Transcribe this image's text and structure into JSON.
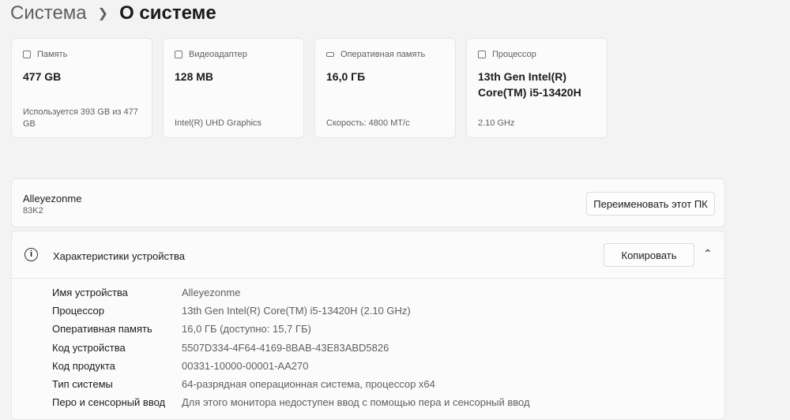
{
  "breadcrumb": {
    "parent": "Система",
    "current": "О системе"
  },
  "cards": [
    {
      "icon": "storage-icon",
      "label": "Память",
      "value": "477 GB",
      "sub": "Используется 393 GB из 477 GB"
    },
    {
      "icon": "display-adapter-icon",
      "label": "Видеоадаптер",
      "value": "128 MB",
      "sub": "Intel(R) UHD Graphics"
    },
    {
      "icon": "ram-icon",
      "label": "Оперативная память",
      "value": "16,0 ГБ",
      "sub": "Скорость: 4800 МТ/с"
    },
    {
      "icon": "cpu-icon",
      "label": "Процессор",
      "value": "13th Gen Intel(R) Core(TM) i5-13420H",
      "sub": "2.10 GHz"
    }
  ],
  "device": {
    "name": "Alleyezonme",
    "model": "83K2",
    "rename_label": "Переименовать этот ПК"
  },
  "specs": {
    "title": "Характеристики устройства",
    "copy_label": "Копировать",
    "rows": [
      {
        "k": "Имя устройства",
        "v": "Alleyezonme"
      },
      {
        "k": "Процессор",
        "v": "13th Gen Intel(R) Core(TM) i5-13420H (2.10 GHz)"
      },
      {
        "k": "Оперативная память",
        "v": "16,0 ГБ (доступно: 15,7 ГБ)"
      },
      {
        "k": "Код устройства",
        "v": "5507D334-4F64-4169-8BAB-43E83ABD5826"
      },
      {
        "k": "Код продукта",
        "v": "00331-10000-00001-AA270"
      },
      {
        "k": "Тип системы",
        "v": "64-разрядная операционная система, процессор x64"
      },
      {
        "k": "Перо и сенсорный ввод",
        "v": "Для этого монитора недоступен ввод с помощью пера и сенсорный ввод"
      }
    ]
  }
}
